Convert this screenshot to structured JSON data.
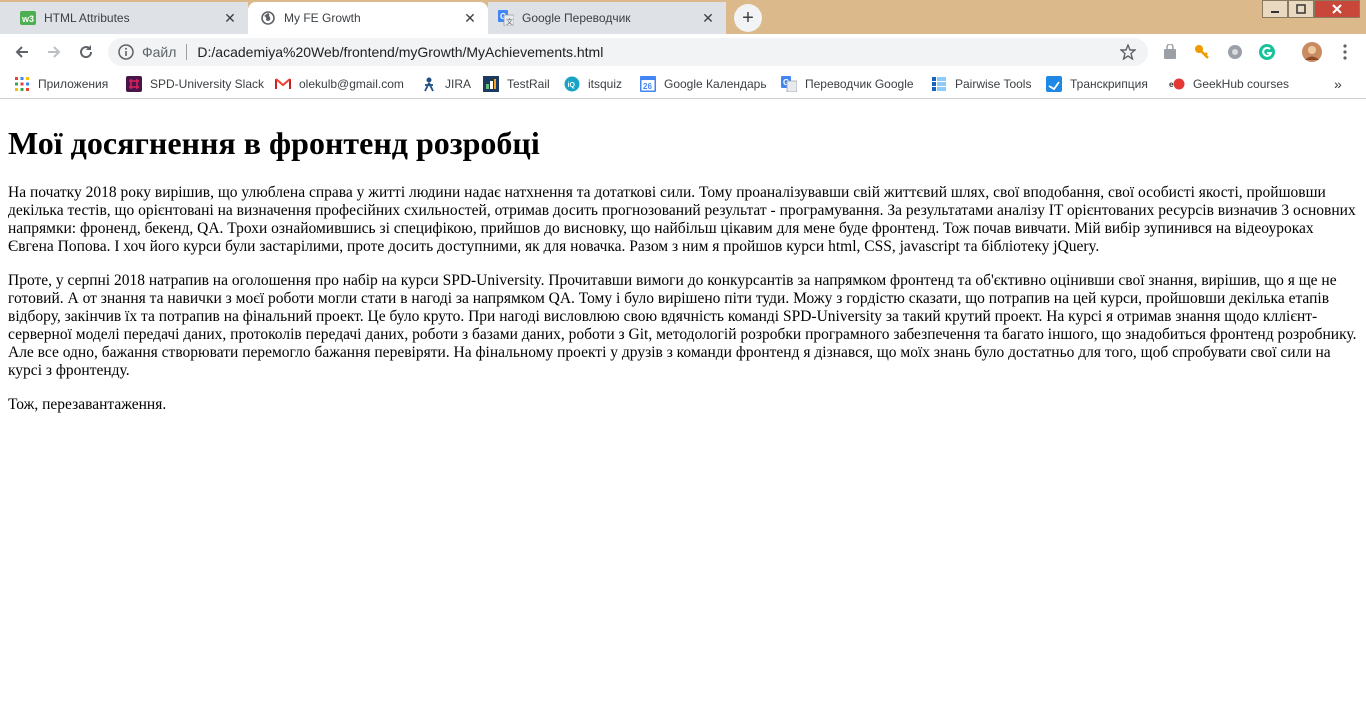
{
  "tabs": [
    {
      "title": "HTML Attributes",
      "favicon": "w3schools-icon"
    },
    {
      "title": "My FE Growth",
      "favicon": "globe-icon"
    },
    {
      "title": "Google Переводчик",
      "favicon": "google-translate-icon"
    }
  ],
  "toolbar": {
    "scheme_label": "Файл",
    "url": "D:/academiya%20Web/frontend/myGrowth/MyAchievements.html"
  },
  "bookmarks": [
    {
      "label": "Приложения",
      "icon": "apps-grid-icon"
    },
    {
      "label": "SPD-University Slack",
      "icon": "slack-icon"
    },
    {
      "label": "olekulb@gmail.com",
      "icon": "gmail-icon"
    },
    {
      "label": "JIRA",
      "icon": "jira-icon"
    },
    {
      "label": "TestRail",
      "icon": "testrail-icon"
    },
    {
      "label": "itsquiz",
      "icon": "itsquiz-icon"
    },
    {
      "label": "Google Календарь",
      "icon": "calendar-icon",
      "icon_text": "26"
    },
    {
      "label": "Переводчик Google",
      "icon": "google-translate-icon"
    },
    {
      "label": "Pairwise Tools",
      "icon": "pairwise-icon"
    },
    {
      "label": "Транскрипция",
      "icon": "transcription-icon"
    },
    {
      "label": "GeekHub courses",
      "icon": "geekhub-icon"
    }
  ],
  "page": {
    "heading": "Мої досягнення в фронтенд розробці",
    "paragraphs": [
      "На початку 2018 року вирішив, що улюблена справа у житті людини надає натхнення та дотаткові сили. Тому проаналізувавши свій життєвий шлях, свої вподобання, свої особисті якості, пройшовши декілька тестів, що орієнтовані на визначення професійних схильностей, отримав досить прогнозований результат - програмування. За результатами аналізу IT орієнтованих ресурсів визначив 3 основних напрямки: фроненд, бекенд, QA. Трохи ознайомившись зі специфікою, прийшов до висновку, що найбільш цікавим для мене буде фронтенд. Тож почав вивчати. Мій вибір зупинився на відеоуроках Євгена Попова. І хоч його курси були застарілими, проте досить доступними, як для новачка. Разом з ним я пройшов курси html, CSS, javascript та бібліотеку jQuery.",
      "Проте, у серпні 2018 натрапив на оголошення про набір на курси SPD-University. Прочитавши вимоги до конкурсантів за напрямком фронтенд та об'єктивно оцінивши свої знання, вирішив, що я ще не готовий. А от знання та навички з моєї роботи могли стати в нагоді за напрямком QA. Тому і було вирішено піти туди. Можу з гордістю сказати, що потрапив на цей курси, пройшовши декілька етапів відбору, закінчив їх та потрапив на фінальний проект. Це було круто. При нагоді висловлюю свою вдячність команді SPD-University за такий крутий проект. На курсі я отримав знання щодо кллієнт-серверної моделі передачі даних, протоколів передачі даних, роботи з базами даних, роботи з Git, методологій розробки програмного забезпечення та багато іншого, що знадобиться фронтенд розробнику. Але все одно, бажання створювати перемогло бажання перевіряти. На фінальному проекті у друзів з команди фронтенд я дізнався, що моїх знань було достатньо для того, щоб спробувати свої сили на курсі з фронтенду.",
      "Тож, перезавантаження."
    ]
  }
}
